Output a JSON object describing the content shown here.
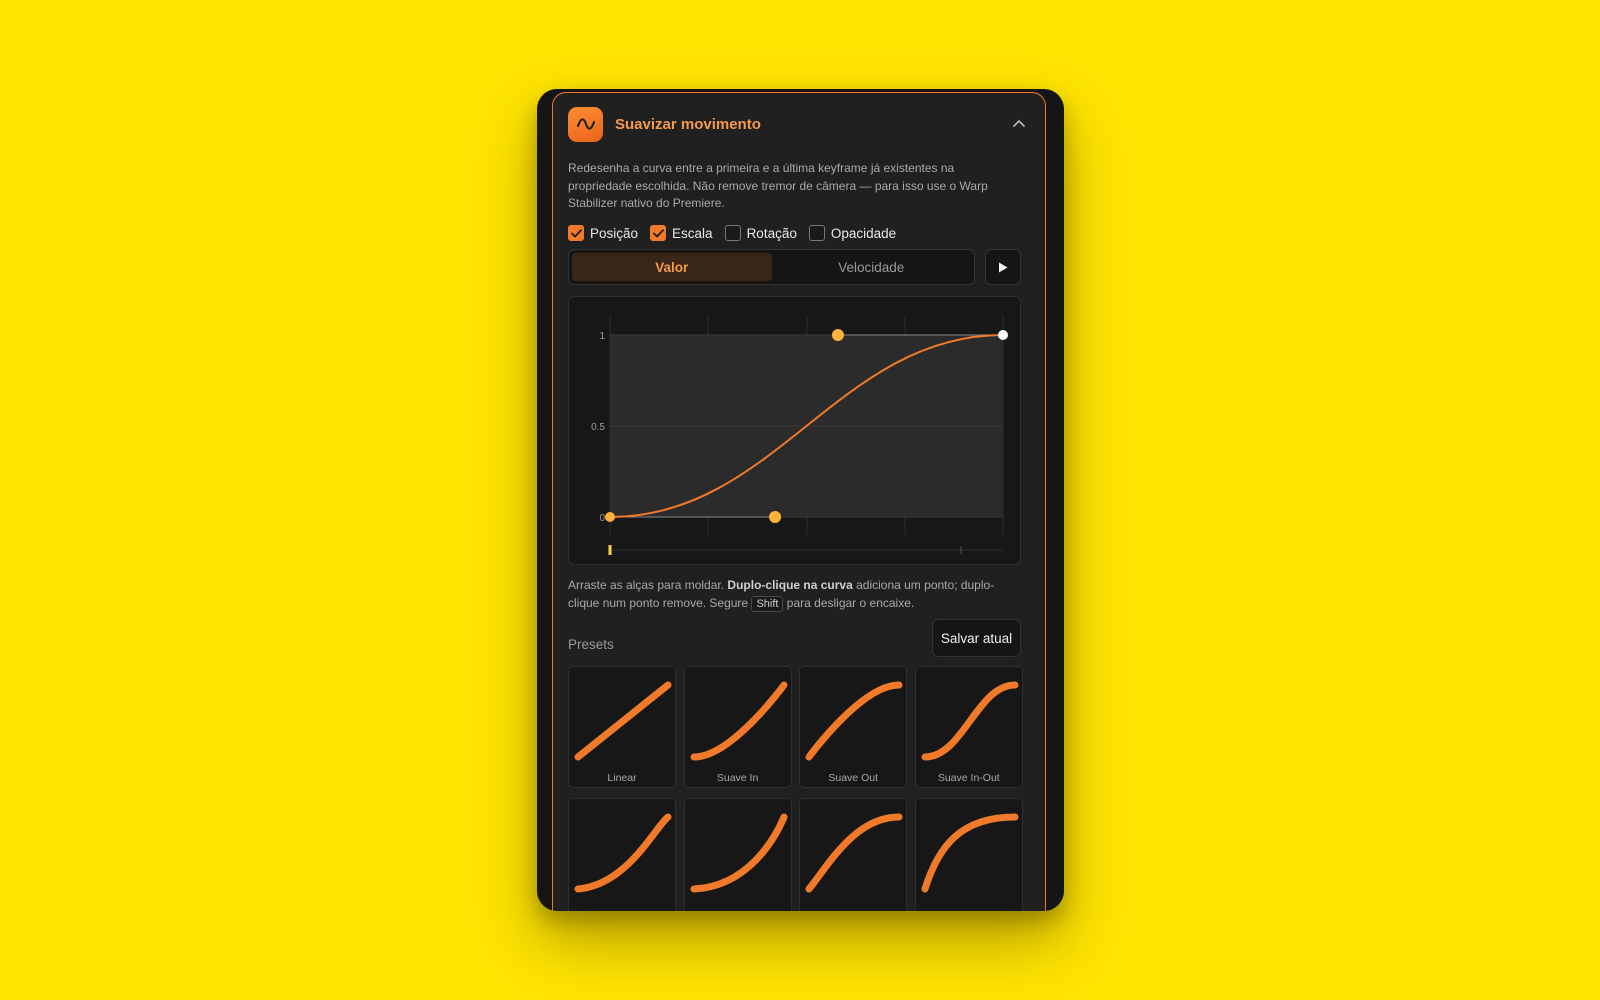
{
  "panel": {
    "title": "Suavizar movimento",
    "app_icon": "wave-icon",
    "collapse_icon": "chevron-up-icon",
    "description": "Redesenha a curva entre a primeira e a última keyframe já existentes na propriedade escolhida. Não remove tremor de câmera — para isso use o Warp Stabilizer nativo do Premiere."
  },
  "properties": [
    {
      "label": "Posição",
      "checked": true
    },
    {
      "label": "Escala",
      "checked": true
    },
    {
      "label": "Rotação",
      "checked": false
    },
    {
      "label": "Opacidade",
      "checked": false
    }
  ],
  "mode_tabs": {
    "value_label": "Valor",
    "speed_label": "Velocidade",
    "active": "Valor",
    "play_icon": "play-icon"
  },
  "curve_editor": {
    "y_ticks": [
      "1",
      "0.5",
      "0"
    ],
    "bezier": {
      "p1": [
        0.42,
        0
      ],
      "p2": [
        0.58,
        1
      ]
    },
    "accent": "#F07A2A"
  },
  "hint": {
    "part1": "Arraste as alças para moldar. ",
    "bold": "Duplo-clique na curva",
    "part2": " adiciona um ponto; duplo-clique num ponto remove. Segure ",
    "key": "Shift",
    "part3": " para desligar o encaixe."
  },
  "presets": {
    "label": "Presets",
    "save_label": "Salvar atual",
    "items": [
      {
        "label": "Linear",
        "p1": [
          0.33,
          0.33
        ],
        "p2": [
          0.67,
          0.67
        ]
      },
      {
        "label": "Suave In",
        "p1": [
          0.42,
          0
        ],
        "p2": [
          1,
          1
        ]
      },
      {
        "label": "Suave Out",
        "p1": [
          0,
          0
        ],
        "p2": [
          0.58,
          1
        ]
      },
      {
        "label": "Suave In-Out",
        "p1": [
          0.42,
          0
        ],
        "p2": [
          0.58,
          1
        ]
      },
      {
        "label": "",
        "p1": [
          0.55,
          0.06
        ],
        "p2": [
          0.85,
          0.85
        ]
      },
      {
        "label": "",
        "p1": [
          0.6,
          0.04
        ],
        "p2": [
          0.9,
          0.7
        ]
      },
      {
        "label": "",
        "p1": [
          0.2,
          0.3
        ],
        "p2": [
          0.5,
          1
        ]
      },
      {
        "label": "",
        "p1": [
          0.15,
          0.6
        ],
        "p2": [
          0.4,
          1
        ]
      }
    ]
  }
}
